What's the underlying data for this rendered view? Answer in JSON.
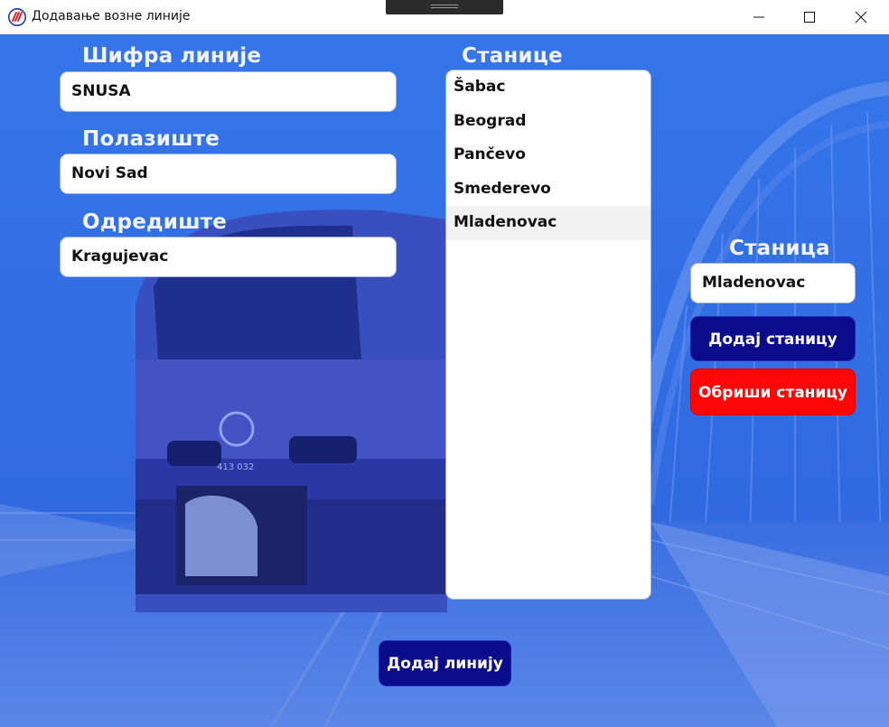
{
  "window": {
    "title": "Додавање возне линије",
    "app_icon": "srbija-voz-logo-icon",
    "controls": [
      "minimize-icon",
      "maximize-icon",
      "close-icon"
    ]
  },
  "form": {
    "line_code": {
      "label": "Шифра линије",
      "value": "SNUSA"
    },
    "origin": {
      "label": "Полазиште",
      "value": "Novi Sad"
    },
    "destination": {
      "label": "Одредиште",
      "value": "Kragujevac"
    }
  },
  "stations": {
    "label": "Станице",
    "items": [
      "Šabac",
      "Beograd",
      "Pančevo",
      "Smederevo",
      "Mladenovac"
    ],
    "selected": "Mladenovac"
  },
  "station_editor": {
    "label": "Станица",
    "value": "Mladenovac",
    "add_label": "Додај станицу",
    "delete_label": "Обриши станицу"
  },
  "actions": {
    "add_line_label": "Додај линију"
  },
  "colors": {
    "background_overlay": "#2f6fe6",
    "primary_button": "#0b0c8c",
    "danger_button": "#ff0606",
    "label_text": "#f1f4ff"
  }
}
